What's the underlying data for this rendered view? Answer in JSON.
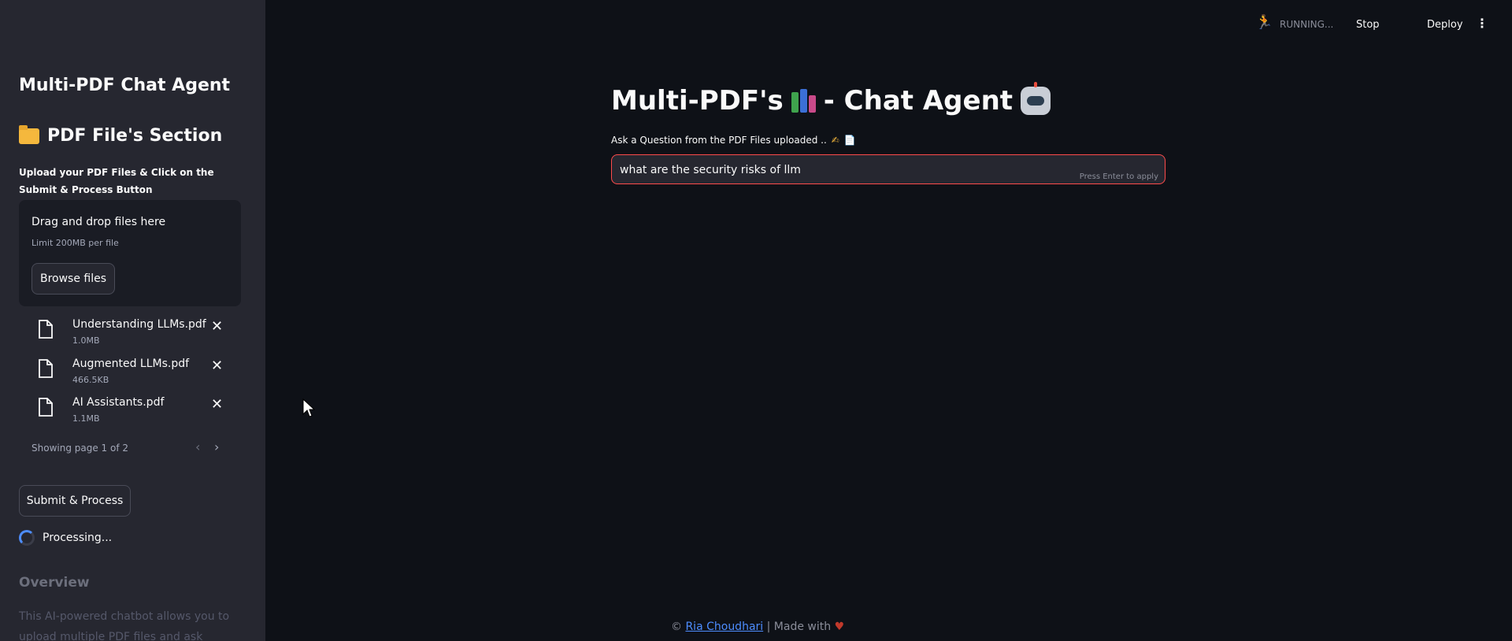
{
  "sidebar": {
    "app_title": "Multi-PDF Chat Agent",
    "section_title": "PDF File's Section",
    "section_icon": "folder-icon",
    "upload_hint": "Upload your PDF Files & Click on the Submit & Process Button",
    "dropzone": {
      "title": "Drag and drop files here",
      "limit": "Limit 200MB per file",
      "browse_label": "Browse files"
    },
    "files": [
      {
        "name": "Understanding LLMs.pdf",
        "size": "1.0MB"
      },
      {
        "name": "Augmented LLMs.pdf",
        "size": "466.5KB"
      },
      {
        "name": "AI Assistants.pdf",
        "size": "1.1MB"
      }
    ],
    "pager": "Showing page 1 of 2",
    "submit_label": "Submit & Process",
    "processing_label": "Processing...",
    "overview_title": "Overview",
    "overview_text": "This AI-powered chatbot allows you to upload multiple PDF files and ask detailed"
  },
  "topbar": {
    "running": "RUNNING...",
    "stop": "Stop",
    "deploy": "Deploy"
  },
  "main": {
    "title_part1": "Multi-PDF's",
    "title_part2": "- Chat Agent",
    "question_label": "Ask a Question from the PDF Files uploaded ..",
    "question_value": "what are the security risks of llm",
    "enter_hint": "Press Enter to apply"
  },
  "footer": {
    "prefix": "©",
    "author": "Ria Choudhari",
    "suffix": "| Made with"
  },
  "colors": {
    "background": "#0e1117",
    "sidebar": "#262730",
    "accent": "#ff4b4b",
    "link": "#4d8dff"
  }
}
